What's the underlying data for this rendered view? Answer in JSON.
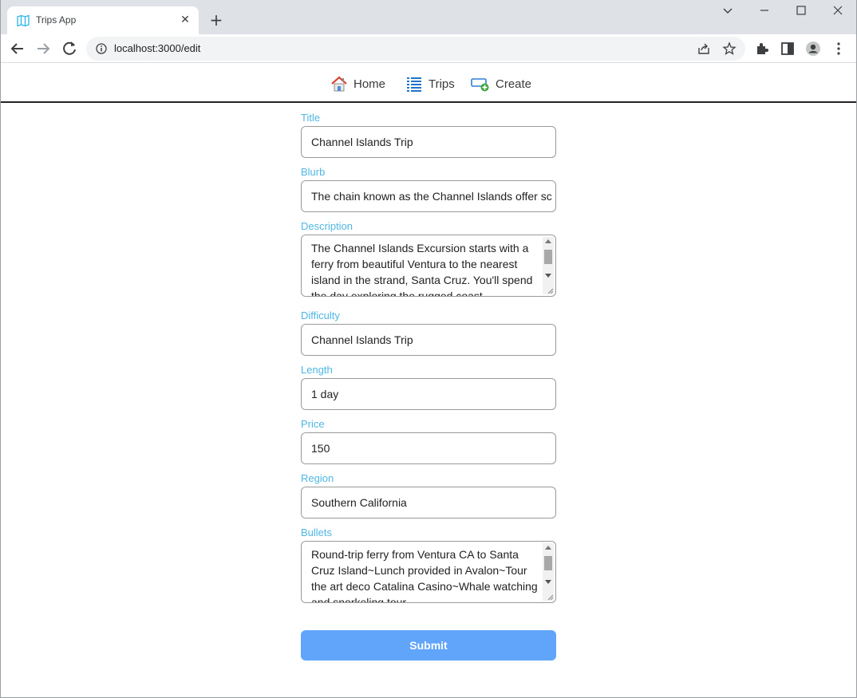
{
  "browser": {
    "tab_title": "Trips App",
    "tab_close": "✕",
    "new_tab": "+",
    "url": "localhost:3000/edit",
    "window_controls": {
      "dropdown": "⌄",
      "minimize": "—",
      "maximize": "☐",
      "close": "✕"
    }
  },
  "appnav": {
    "items": [
      {
        "label": "Home",
        "icon": "house-icon"
      },
      {
        "label": "Trips",
        "icon": "list-icon"
      },
      {
        "label": "Create",
        "icon": "create-icon"
      }
    ]
  },
  "form": {
    "fields": [
      {
        "label": "Title",
        "value": "Channel Islands Trip",
        "type": "input"
      },
      {
        "label": "Blurb",
        "value": "The chain known as the Channel Islands offer sc",
        "type": "input"
      },
      {
        "label": "Description",
        "value": "The Channel Islands Excursion starts with a ferry from beautiful Ventura to the nearest island in the strand, Santa Cruz. You'll spend the day exploring the rugged coast",
        "type": "textarea"
      },
      {
        "label": "Difficulty",
        "value": "Channel Islands Trip",
        "type": "input"
      },
      {
        "label": "Length",
        "value": "1 day",
        "type": "input"
      },
      {
        "label": "Price",
        "value": "150",
        "type": "input"
      },
      {
        "label": "Region",
        "value": "Southern California",
        "type": "input"
      },
      {
        "label": "Bullets",
        "value": "Round-trip ferry from Ventura CA to Santa Cruz Island~Lunch provided in Avalon~Tour the art deco Catalina Casino~Whale watching and snorkeling tour",
        "type": "textarea"
      }
    ],
    "submit_label": "Submit"
  },
  "colors": {
    "label": "#4fb7e5",
    "submit_bg": "#60a5fa",
    "chrome_bg": "#dee1e6"
  }
}
